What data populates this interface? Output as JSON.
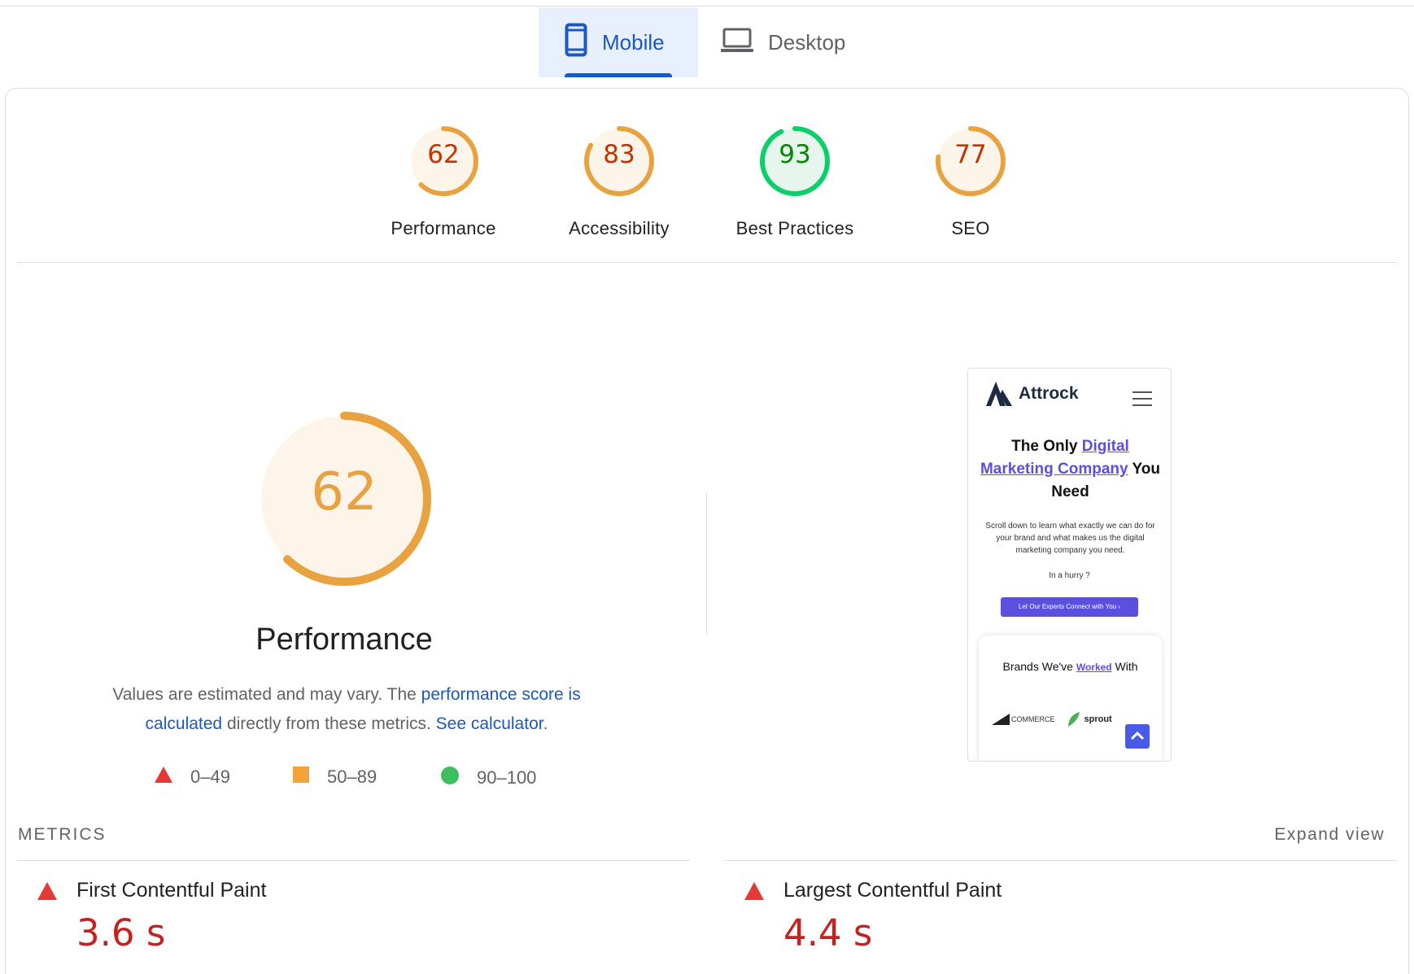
{
  "tabs": [
    {
      "label": "Mobile",
      "icon": "smartphone-icon",
      "active": true
    },
    {
      "label": "Desktop",
      "icon": "laptop-icon",
      "active": false
    }
  ],
  "categories": [
    {
      "score": "62",
      "label": "Performance",
      "value": 62,
      "status": "average"
    },
    {
      "score": "83",
      "label": "Accessibility",
      "value": 83,
      "status": "average"
    },
    {
      "score": "93",
      "label": "Best Practices",
      "value": 93,
      "status": "pass"
    },
    {
      "score": "77",
      "label": "SEO",
      "value": 77,
      "status": "average"
    }
  ],
  "performance": {
    "score": "62",
    "value": 62,
    "title": "Performance",
    "desc_prefix": "Values are estimated and may vary. The ",
    "desc_link1": "performance score is calculated",
    "desc_middle": " directly from these metrics. ",
    "desc_link2": "See calculator",
    "desc_suffix": "."
  },
  "legend": [
    {
      "icon": "fail-triangle-icon",
      "range": "0–49"
    },
    {
      "icon": "average-square-icon",
      "range": "50–89"
    },
    {
      "icon": "pass-circle-icon",
      "range": "90–100"
    }
  ],
  "thumbnail": {
    "brand": "Attrock",
    "headline_1": "The Only ",
    "headline_link": "Digital Marketing Company",
    "headline_2": " You Need",
    "sub": "Scroll down to learn what exactly we can do for your brand and what makes us the digital marketing company you need.",
    "hurry": "In a hurry ?",
    "cta": "Let Our Experts Connect with You  ›",
    "brands_prefix": "Brands We've ",
    "brands_link": "Worked",
    "brands_suffix": " With",
    "logo1": "COMMERCE",
    "logo2": "sprout"
  },
  "metrics": {
    "heading": "METRICS",
    "expand": "Expand view",
    "items": [
      {
        "name": "First Contentful Paint",
        "value": "3.6 s",
        "status": "fail"
      },
      {
        "name": "Largest Contentful Paint",
        "value": "4.4 s",
        "status": "fail"
      }
    ]
  },
  "colors": {
    "accent": "#1a57c7",
    "average": "#e8a23f",
    "average_text": "#c33300",
    "average_bg": "#fef5ea",
    "pass": "#0cce6b",
    "pass_text": "#008800",
    "pass_bg": "#e6f6ec",
    "fail": "#e53935",
    "fail_text": "#c5221f"
  }
}
